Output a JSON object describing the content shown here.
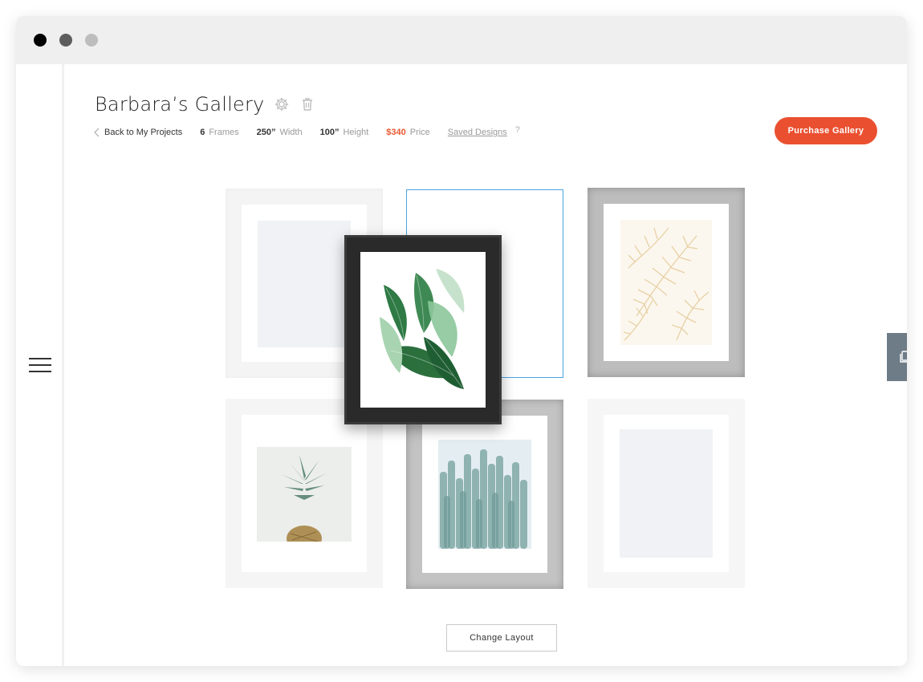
{
  "window": {
    "dots": [
      "close",
      "minimize",
      "maximize"
    ]
  },
  "sidebar": {
    "menu_icon": "hamburger-icon"
  },
  "header": {
    "title": "Barbara’s Gallery",
    "settings_icon": "gear-icon",
    "delete_icon": "trash-icon",
    "back_label": "Back to My Projects",
    "frames_value": "6",
    "frames_label": "Frames",
    "width_value": "250”",
    "width_label": "Width",
    "height_value": "100”",
    "height_label": "Height",
    "price_value": "$340",
    "price_label": "Price",
    "saved_designs_label": "Saved Designs",
    "help_label": "?",
    "purchase_label": "Purchase Gallery"
  },
  "side_panel": {
    "icon": "copy-icon"
  },
  "gallery": {
    "frames": [
      {
        "id": "frame-1",
        "finish": "white",
        "art": "empty"
      },
      {
        "id": "frame-2",
        "finish": "placeholder-selected",
        "art": "empty"
      },
      {
        "id": "frame-3",
        "finish": "silver",
        "art": "palm leaves"
      },
      {
        "id": "frame-4",
        "finish": "white",
        "art": "pineapple"
      },
      {
        "id": "frame-5",
        "finish": "silver",
        "art": "cactus"
      },
      {
        "id": "frame-6",
        "finish": "white",
        "art": "empty"
      }
    ],
    "dragged_frame": {
      "finish": "black",
      "art": "banana leaves"
    }
  },
  "footer": {
    "change_layout_label": "Change Layout"
  },
  "colors": {
    "accent": "#ea5030",
    "selection": "#4aa4e0",
    "side_tab": "#6e7c87"
  }
}
